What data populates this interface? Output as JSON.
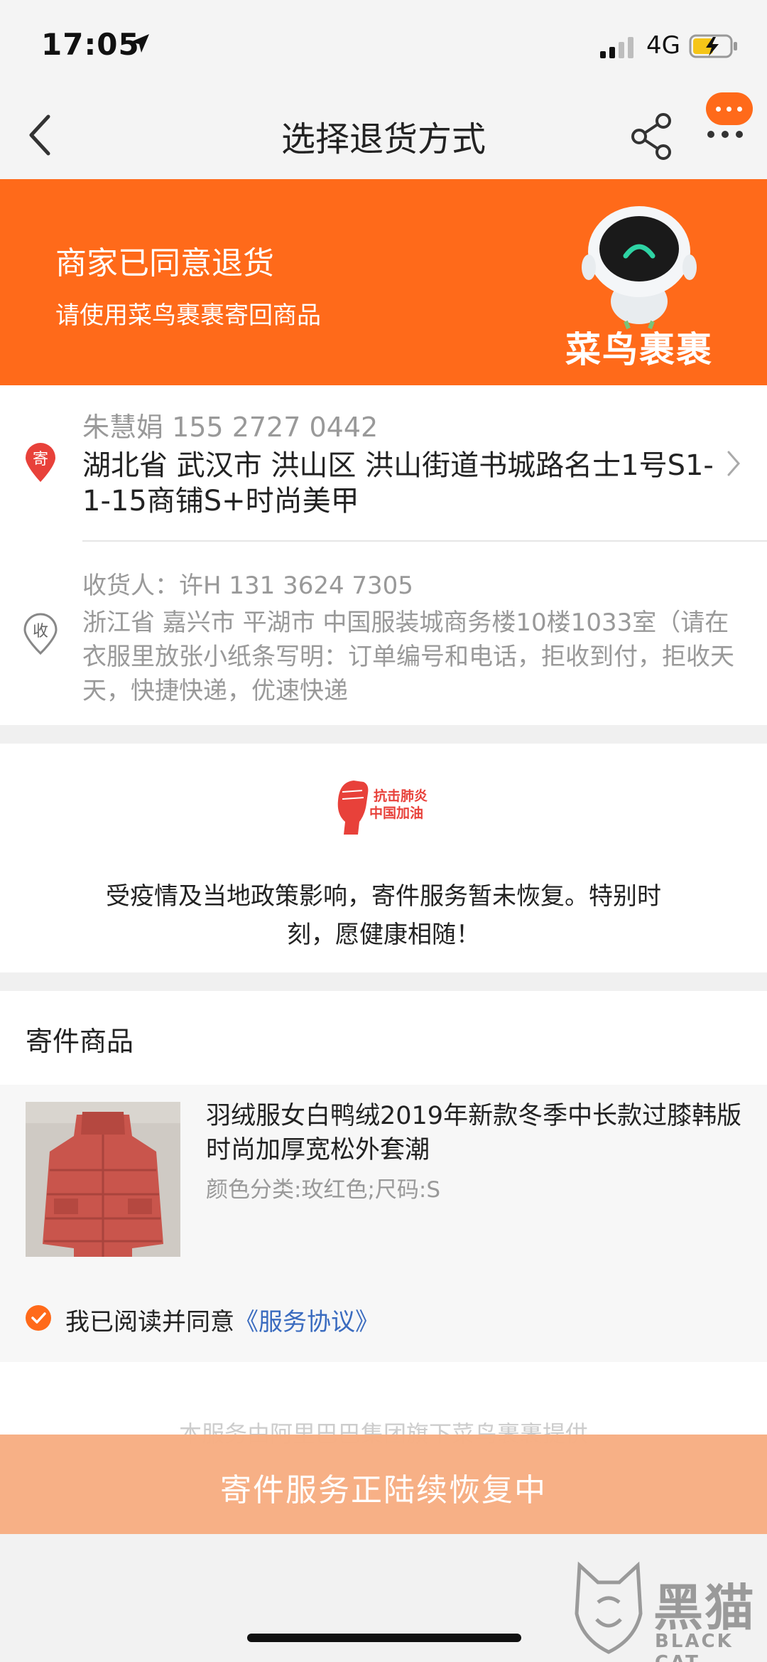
{
  "status_bar": {
    "time": "17:05",
    "network": "4G"
  },
  "nav": {
    "title": "选择退货方式"
  },
  "banner": {
    "title": "商家已同意退货",
    "subtitle": "请使用菜鸟裹裹寄回商品",
    "brand": "菜鸟裹裹"
  },
  "sender": {
    "badge": "寄",
    "name_phone": "朱慧娟  155 2727 0442",
    "address": "湖北省 武汉市 洪山区 洪山街道书城路名士1号S1-1-15商铺S+时尚美甲"
  },
  "receiver": {
    "badge": "收",
    "name_phone": "收货人：许H  131 3624 7305",
    "address": "浙江省 嘉兴市 平湖市 中国服装城商务楼10楼1033室（请在衣服里放张小纸条写明：订单编号和电话，拒收到付，拒收天天，快捷快递，优速快递"
  },
  "notice": {
    "logo_line1": "抗击肺炎",
    "logo_line2": "中国加油",
    "text": "受疫情及当地政策影响，寄件服务暂未恢复。特别时刻，愿健康相随！"
  },
  "goods": {
    "section_title": "寄件商品",
    "name": "羽绒服女白鸭绒2019年新款冬季中长款过膝韩版时尚加厚宽松外套潮",
    "spec": "颜色分类:玫红色;尺码:S"
  },
  "agreement": {
    "text": "我已阅读并同意",
    "link": "《服务协议》"
  },
  "footer": {
    "note": "—  本服务由阿里巴巴集团旗下菜鸟裹裹提供  —",
    "cta": "寄件服务正陆续恢复中"
  },
  "watermark": {
    "text": "黑猫",
    "sub": "BLACK CAT"
  },
  "colors": {
    "accent": "#ff6a1a",
    "cta_disabled": "#f7ae84",
    "link": "#3a6bbf"
  }
}
